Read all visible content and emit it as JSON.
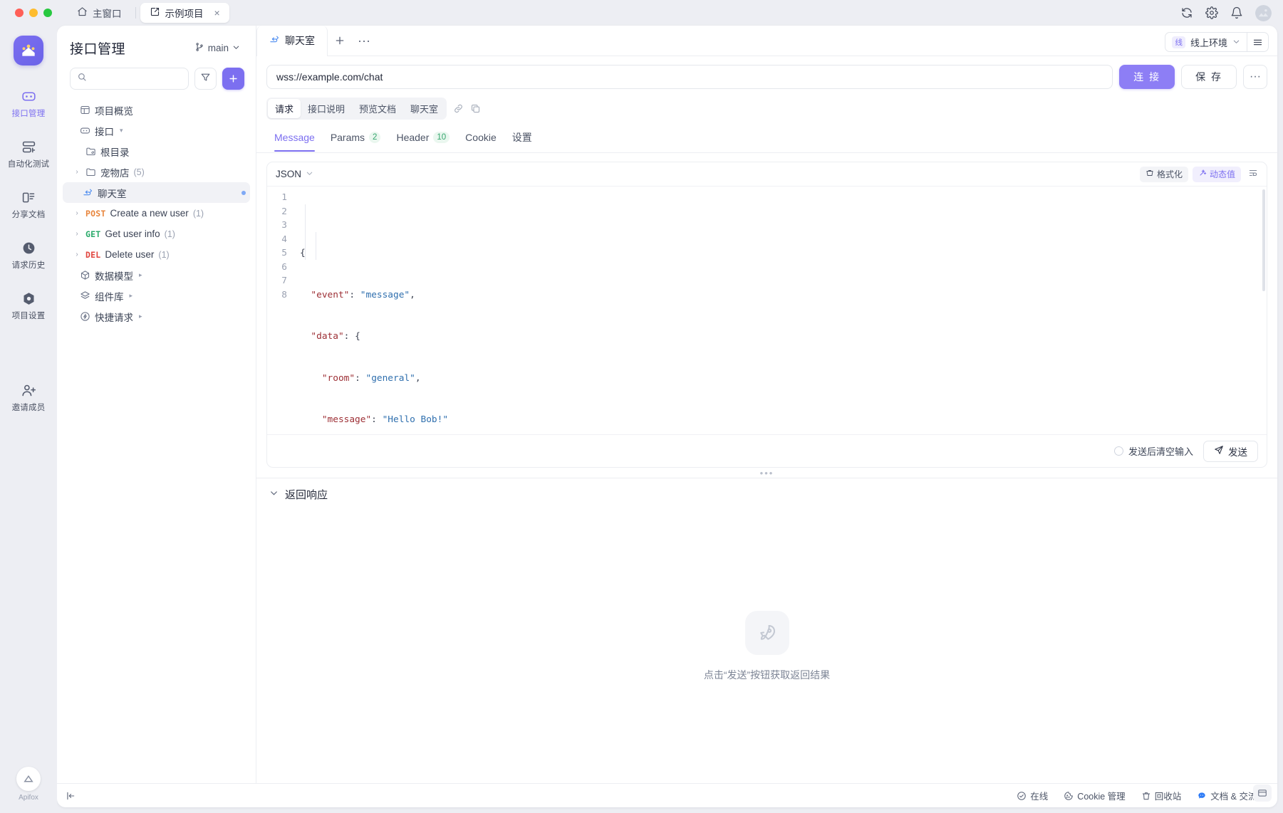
{
  "titlebar": {
    "home_tab": "主窗口",
    "project_tab": "示例项目",
    "close_label": "×",
    "icons": [
      "refresh-icon",
      "gear-icon",
      "bell-icon",
      "avatar"
    ]
  },
  "rail": {
    "items": [
      {
        "label": "接口管理",
        "icon": "api-icon",
        "active": true
      },
      {
        "label": "自动化测试",
        "icon": "automation-icon",
        "active": false
      },
      {
        "label": "分享文档",
        "icon": "share-doc-icon",
        "active": false
      },
      {
        "label": "请求历史",
        "icon": "clock-icon",
        "active": false
      },
      {
        "label": "项目设置",
        "icon": "settings-icon",
        "active": false
      },
      {
        "label": "邀请成员",
        "icon": "invite-user-icon",
        "active": false
      }
    ],
    "brand": "Apifox"
  },
  "sidebar": {
    "title": "接口管理",
    "branch": "main",
    "search_placeholder": "",
    "filter_icon": "filter-icon",
    "add_label": "+",
    "tree": [
      {
        "label": "项目概览",
        "icon": "overview-icon",
        "level": 0,
        "caret": false,
        "expandable": false
      },
      {
        "label": "接口",
        "icon": "api-folder-icon",
        "level": 0,
        "caret": false,
        "mini_caret": true
      },
      {
        "label": "根目录",
        "icon": "root-folder-icon",
        "level": 1,
        "caret": false
      },
      {
        "label": "宠物店",
        "count": "(5)",
        "icon": "folder-icon",
        "level": 1,
        "caret": true
      },
      {
        "label": "聊天室",
        "icon": "websocket-icon",
        "level": 2,
        "caret": false,
        "selected": true,
        "dot": true
      },
      {
        "label": "Create a new user",
        "count": "(1)",
        "method": "POST",
        "method_class": "m-post",
        "level": 1,
        "caret": true
      },
      {
        "label": "Get user info",
        "count": "(1)",
        "method": "GET",
        "method_class": "m-get",
        "level": 1,
        "caret": true
      },
      {
        "label": "Delete user",
        "count": "(1)",
        "method": "DEL",
        "method_class": "m-del",
        "level": 1,
        "caret": true
      },
      {
        "label": "数据模型",
        "icon": "cube-icon",
        "level": 0,
        "caret": false,
        "mini_caret": true
      },
      {
        "label": "组件库",
        "icon": "layers-icon",
        "level": 0,
        "caret": false,
        "mini_caret": true
      },
      {
        "label": "快捷请求",
        "icon": "bolt-icon",
        "level": 0,
        "caret": false,
        "mini_caret": true
      }
    ]
  },
  "content": {
    "doc_tab": "聊天室",
    "doc_tab_icon": "websocket-icon",
    "new_tab_label": "+",
    "more_tabs_label": "···",
    "env": {
      "badge": "线",
      "name": "线上环境"
    },
    "menu_icon": "hamburger-icon",
    "url": "wss://example.com/chat",
    "connect_label": "连 接",
    "save_label": "保 存",
    "more_label": "···",
    "segmented": [
      {
        "label": "请求",
        "active": true
      },
      {
        "label": "接口说明",
        "active": false
      },
      {
        "label": "预览文档",
        "active": false
      }
    ],
    "breadcrumb": "聊天室",
    "breadcrumb_icons": [
      "link-icon",
      "copy-icon"
    ],
    "subtabs": [
      {
        "label": "Message",
        "badge": "",
        "active": true
      },
      {
        "label": "Params",
        "badge": "2",
        "active": false
      },
      {
        "label": "Header",
        "badge": "10",
        "active": false
      },
      {
        "label": "Cookie",
        "badge": "",
        "active": false
      },
      {
        "label": "设置",
        "badge": "",
        "active": false
      }
    ],
    "editor": {
      "language": "JSON",
      "format_label": "格式化",
      "dynamic_label": "动态值",
      "wrap_icon": "wrap-lines-icon",
      "lines": [
        {
          "n": "1",
          "html": "<span class=\"tok-punc\">{</span>"
        },
        {
          "n": "2",
          "html": "  <span class=\"tok-key\">\"event\"</span><span class=\"tok-punc\">: </span><span class=\"tok-str\">\"message\"</span><span class=\"tok-punc\">,</span>"
        },
        {
          "n": "3",
          "html": "  <span class=\"tok-key\">\"data\"</span><span class=\"tok-punc\">: {</span>"
        },
        {
          "n": "4",
          "html": "    <span class=\"tok-key\">\"room\"</span><span class=\"tok-punc\">: </span><span class=\"tok-str\">\"general\"</span><span class=\"tok-punc\">,</span>"
        },
        {
          "n": "5",
          "html": "    <span class=\"tok-key\">\"message\"</span><span class=\"tok-punc\">: </span><span class=\"tok-str\">\"Hello Bob!\"</span>"
        },
        {
          "n": "6",
          "html": "  <span class=\"tok-punc\">}</span>"
        },
        {
          "n": "7",
          "html": "<span class=\"tok-punc\">}</span>"
        },
        {
          "n": "8",
          "html": ""
        }
      ]
    },
    "clear_after_send_label": "发送后清空输入",
    "send_label": "发送"
  },
  "response": {
    "title": "返回响应",
    "collapse_icon": "chevron-down-icon",
    "empty_icon": "rocket-icon",
    "empty_text": "点击“发送”按钮获取返回结果",
    "float_icon": "panel-icon"
  },
  "statusbar": {
    "collapse_icon": "collapse-left-icon",
    "items": [
      {
        "label": "在线",
        "icon": "check-circle-icon"
      },
      {
        "label": "Cookie 管理",
        "icon": "cookie-icon"
      },
      {
        "label": "回收站",
        "icon": "trash-icon"
      },
      {
        "label": "文档 & 交流群",
        "icon": "chat-icon"
      }
    ]
  },
  "colors": {
    "accent": "#7c6ff0",
    "connect": "#8d7ef5",
    "get": "#2bab6b",
    "post": "#e8853c",
    "delete": "#e1463f",
    "badge_green": "#35a56d"
  }
}
